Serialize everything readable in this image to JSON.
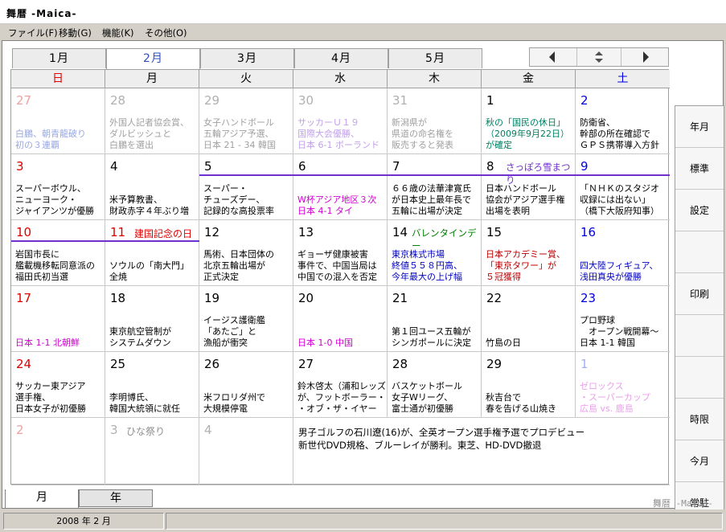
{
  "window": {
    "title": "舞暦 -Maica-"
  },
  "menu": [
    "ファイル(F)",
    "移動(G)",
    "機能(K)",
    "その他(O)"
  ],
  "month_tabs": [
    "1月",
    "2月",
    "3月",
    "4月",
    "5月"
  ],
  "active_month_index": 1,
  "weekdays": [
    "日",
    "月",
    "火",
    "水",
    "木",
    "金",
    "土"
  ],
  "colors": {
    "sunday": "#e00000",
    "saturday": "#0000e0",
    "holiday": "#e00000",
    "outside_month": "#b0b0b0",
    "bar": "#7030d0"
  },
  "weeks": [
    [
      {
        "day": "27",
        "cls": "out",
        "note": "白鵬、朝青龍破り\n初の３連覇",
        "note_color": "#9aa8e0"
      },
      {
        "day": "28",
        "cls": "out",
        "note": "外国人記者協会賞、\nダルビッシュと\n白鵬を選出",
        "note_color": "#a0a0a0"
      },
      {
        "day": "29",
        "cls": "out",
        "note": "女子ハンドボール\n五輪アジア予選、\n日本 21 - 34 韓国",
        "note_color": "#a0a0a0"
      },
      {
        "day": "30",
        "cls": "out",
        "note": "サッカーＵ１９\n国際大会優勝、\n日本 6-1 ボーランド",
        "note_color": "#c0a0e8"
      },
      {
        "day": "31",
        "cls": "out",
        "note": "新潟県が\n県道の命名権を\n販売すると発表",
        "note_color": "#a0a0a0"
      },
      {
        "day": "1",
        "cls": "",
        "note": "秋の「国民の休日」\n（2009年9月22日）\nが確定",
        "note_color": "#008060"
      },
      {
        "day": "2",
        "cls": "sat",
        "note": "防衛省、\n幹部の所在確認で\nＧＰＳ携帯導入方針",
        "note_color": "#000"
      }
    ],
    [
      {
        "day": "3",
        "cls": "sun",
        "note": "スーパーボウル、\nニューヨーク・\nジャイアンツが優勝",
        "note_color": "#000"
      },
      {
        "day": "4",
        "cls": "",
        "note": "米予算教書、\n財政赤字４年ぶり増",
        "note_color": "#000"
      },
      {
        "day": "5",
        "cls": "",
        "note": "スーパー・\nチューズデー、\n記録的な高投票率",
        "note_color": "#000"
      },
      {
        "day": "6",
        "cls": "",
        "note": "W杯アジア地区３次\n日本 4-1 タイ",
        "note_color": "#d000d0"
      },
      {
        "day": "7",
        "cls": "",
        "note": "６６歳の法華津寛氏\nが日本史上最年長で\n五輪に出場が決定",
        "note_color": "#000"
      },
      {
        "day": "8",
        "cls": "",
        "event": "さっぽろ雪まつり",
        "note": "日本ハンドボール\n協会がアジア選手権\n出場を表明",
        "note_color": "#000"
      },
      {
        "day": "9",
        "cls": "sat",
        "note": "「ＮＨＫのスタジオ\n収録には出ない」\n（橋下大阪府知事）",
        "note_color": "#000"
      }
    ],
    [
      {
        "day": "10",
        "cls": "sun",
        "note": "岩国市長に\n艦載機移転同意派の\n福田氏初当選",
        "note_color": "#000"
      },
      {
        "day": "11",
        "cls": "sun",
        "holiday": "建国記念の日",
        "note": "ソウルの「南大門」\n全焼",
        "note_color": "#000"
      },
      {
        "day": "12",
        "cls": "",
        "note": "馬術、日本団体の\n北京五輪出場が\n正式決定",
        "note_color": "#000"
      },
      {
        "day": "13",
        "cls": "",
        "note": "ギョーザ健康被害\n事件で、中国当局は\n中国での混入を否定",
        "note_color": "#000"
      },
      {
        "day": "14",
        "cls": "",
        "event": "バレンタインデー",
        "note": "東京株式市場\n終値５５８円高、\n今年最大の上げ幅",
        "note_color": "#0000c0"
      },
      {
        "day": "15",
        "cls": "",
        "note": "日本アカデミー賞、\n「東京タワー」が\n５冠獲得",
        "note_color": "#c00000"
      },
      {
        "day": "16",
        "cls": "sat",
        "note": "四大陸フィギュア、\n浅田真央が優勝",
        "note_color": "#0000c0"
      }
    ],
    [
      {
        "day": "17",
        "cls": "sun",
        "note": "日本 1-1 北朝鮮",
        "note_color": "#d000d0"
      },
      {
        "day": "18",
        "cls": "",
        "note": "東京航空管制が\nシステムダウン",
        "note_color": "#000"
      },
      {
        "day": "19",
        "cls": "",
        "note": "イージス護衛艦\n「あたご」と\n漁船が衝突",
        "note_color": "#000"
      },
      {
        "day": "20",
        "cls": "",
        "note": "日本 1-0 中国",
        "note_color": "#d000d0"
      },
      {
        "day": "21",
        "cls": "",
        "note": "第１回ユース五輪が\nシンガポールに決定",
        "note_color": "#000"
      },
      {
        "day": "22",
        "cls": "",
        "note": "竹島の日",
        "note_color": "#000"
      },
      {
        "day": "23",
        "cls": "sat",
        "note": "プロ野球\n　オープン戦開幕～\n日本 1-1 韓国",
        "note_color": "#000"
      }
    ],
    [
      {
        "day": "24",
        "cls": "sun",
        "note": "サッカー東アジア\n選手権、\n日本女子が初優勝",
        "note_color": "#000"
      },
      {
        "day": "25",
        "cls": "",
        "note": "李明博氏、\n韓国大統領に就任",
        "note_color": "#000"
      },
      {
        "day": "26",
        "cls": "",
        "note": "米フロリダ州で\n大規模停電",
        "note_color": "#000"
      },
      {
        "day": "27",
        "cls": "",
        "note": "鈴木啓太（浦和レッズ\nが、フットボーラー・\n・オブ・ザ・イヤー",
        "note_color": "#000"
      },
      {
        "day": "28",
        "cls": "",
        "note": "バスケットボール\n女子Wリーグ、\n富士通が初優勝",
        "note_color": "#000"
      },
      {
        "day": "29",
        "cls": "",
        "note": "秋吉台で\n春を告げる山焼き",
        "note_color": "#000"
      },
      {
        "day": "1",
        "cls": "out",
        "note": "ゼロックス\n・スーパーカップ\n広島 vs. 鹿島",
        "note_color": "#e8a0e8"
      }
    ],
    [
      {
        "day": "2",
        "cls": "out-sun"
      },
      {
        "day": "3",
        "cls": "out",
        "holiday": "ひな祭り"
      },
      {
        "day": "4",
        "cls": "out"
      }
    ]
  ],
  "week2_sports_note": "日本 4-1 タイ",
  "week3_mon_note": "日本 1-1 韓国",
  "month_notes": "男子ゴルフの石川遼(16)が、全英オープン選手権予選でプロデビュー\n新世代DVD規格、ブルーレイが勝利。東芝、HD-DVD撤退",
  "side_buttons": [
    "年月",
    "標準",
    "設定",
    "",
    "印刷",
    "",
    "",
    "時限",
    "今月",
    "常駐"
  ],
  "view_tabs": [
    "月",
    "年"
  ],
  "active_view_index": 0,
  "watermark": "舞暦 -Maica-",
  "status": {
    "date": "2008 年 2 月"
  }
}
